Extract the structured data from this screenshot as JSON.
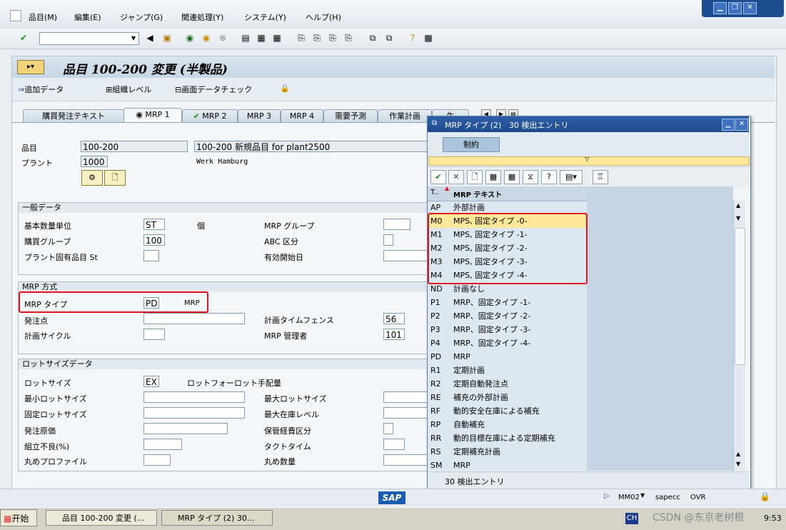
{
  "menu": {
    "items": [
      "品目(M)",
      "編集(E)",
      "ジャンプ(G)",
      "関連処理(Y)",
      "システム(Y)",
      "ヘルプ(H)"
    ]
  },
  "window_controls": {
    "minimize": "▁",
    "restore": "❐",
    "close": "✕"
  },
  "title": "品目 100-200 変更 (半製品)",
  "appbar": {
    "add_data": "追加データ",
    "org_level": "組織レベル",
    "screen_check": "画面データチェック"
  },
  "tabs": [
    "購買発注テキスト",
    "MRP 1",
    "MRP 2",
    "MRP 3",
    "MRP 4",
    "需要予測",
    "作業計画",
    "生"
  ],
  "header": {
    "material_label": "品目",
    "material_value": "100-200",
    "material_desc": "100-200 新規品目 for plant2500",
    "plant_label": "プラント",
    "plant_value": "1000",
    "plant_name": "Werk Hamburg"
  },
  "general": {
    "title": "一般データ",
    "base_uom_label": "基本数量単位",
    "base_uom_value": "ST",
    "base_uom_text": "個",
    "mrp_group_label": "MRP グループ",
    "purch_group_label": "購買グループ",
    "purch_group_value": "100",
    "abc_label": "ABC 区分",
    "plant_status_label": "プラント固有品目 St",
    "valid_from_label": "有効開始日"
  },
  "mrp": {
    "title": "MRP 方式",
    "type_label": "MRP タイプ",
    "type_value": "PD",
    "type_text": "MRP",
    "reorder_label": "発注点",
    "fence_label": "計画タイムフェンス",
    "fence_value": "56",
    "cycle_label": "計画サイクル",
    "controller_label": "MRP 管理者",
    "controller_value": "101"
  },
  "lot": {
    "title": "ロットサイズデータ",
    "lotsize_label": "ロットサイズ",
    "lotsize_value": "EX",
    "lotsize_text": "ロットフォーロット手配量",
    "min_label": "最小ロットサイズ",
    "max_label": "最大ロットサイズ",
    "fixed_label": "固定ロットサイズ",
    "max_stock_label": "最大在庫レベル",
    "cost_label": "発注原価",
    "storage_cost_label": "保管経費区分",
    "scrap_label": "組立不良(%)",
    "takt_label": "タクトタイム",
    "rounding_profile_label": "丸めプロファイル",
    "rounding_value_label": "丸め数量"
  },
  "popup": {
    "title": "MRP タイプ (2)   30 検出エントリ",
    "tab": "制約",
    "col1": "T..",
    "col2": "MRP テキスト",
    "rows": [
      {
        "code": "AP",
        "text": "外部計画"
      },
      {
        "code": "M0",
        "text": "MPS, 固定タイプ -0-"
      },
      {
        "code": "M1",
        "text": "MPS, 固定タイプ -1-"
      },
      {
        "code": "M2",
        "text": "MPS, 固定タイプ -2-"
      },
      {
        "code": "M3",
        "text": "MPS, 固定タイプ -3-"
      },
      {
        "code": "M4",
        "text": "MPS, 固定タイプ -4-"
      },
      {
        "code": "ND",
        "text": "計画なし"
      },
      {
        "code": "P1",
        "text": "MRP、固定タイプ -1-"
      },
      {
        "code": "P2",
        "text": "MRP、固定タイプ -2-"
      },
      {
        "code": "P3",
        "text": "MRP、固定タイプ -3-"
      },
      {
        "code": "P4",
        "text": "MRP、固定タイプ -4-"
      },
      {
        "code": "PD",
        "text": "MRP"
      },
      {
        "code": "R1",
        "text": "定期計画"
      },
      {
        "code": "R2",
        "text": "定期自動発注点"
      },
      {
        "code": "RE",
        "text": "補充の外部計画"
      },
      {
        "code": "RF",
        "text": "動的安全在庫による補充"
      },
      {
        "code": "RP",
        "text": "自動補充"
      },
      {
        "code": "RR",
        "text": "動的目標在庫による定期補充"
      },
      {
        "code": "RS",
        "text": "定期補充計画"
      },
      {
        "code": "SM",
        "text": "MRP"
      }
    ],
    "status": "30 検出エントリ"
  },
  "statusbar": {
    "tcode": "MM02",
    "server": "sapecc",
    "mode": "OVR",
    "logo": "SAP"
  },
  "taskbar": {
    "start": "开始",
    "task1": "品目 100-200 変更 (...",
    "task2": "MRP タイプ (2)   30...",
    "lang": "CH",
    "clock": "9:53",
    "watermark": "CSDN @东京老树根"
  },
  "colors": {
    "highlight_red": "#e0141e",
    "selected_row": "#ffe89a",
    "popup_title": "#1f4b8c"
  }
}
